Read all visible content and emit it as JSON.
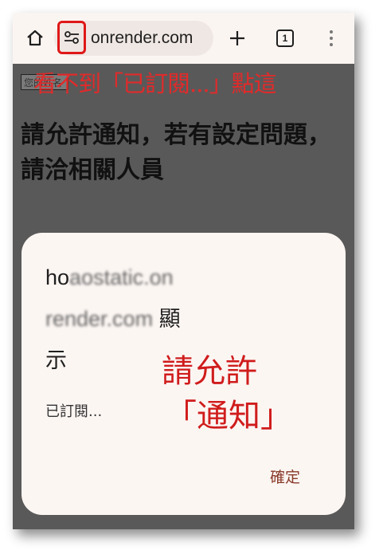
{
  "browser": {
    "url_display": "onrender.com",
    "tab_count": "1",
    "icons": {
      "home": "home-icon",
      "site_settings": "tune-icon",
      "new_tab": "plus-icon",
      "tabs": "tab-switcher-icon",
      "menu": "more-vert-icon"
    }
  },
  "page": {
    "input_placeholder": "您的姓名",
    "heading": "請允許通知，若有設定問題，請洽相關人員"
  },
  "annotations": {
    "top_tip": "看不到「已訂閱...」點這",
    "dialog_tip_line1": "請允許",
    "dialog_tip_line2": "「通知」"
  },
  "dialog": {
    "site_prefix": "ho",
    "site_blurred_1": "aostatic.on",
    "site_blurred_2": "render.com",
    "site_suffix": " 顯",
    "title_end": "示",
    "subtitle": "已訂閱...",
    "ok_label": "確定"
  },
  "colors": {
    "annotation_red": "#e22a2a",
    "highlight_box": "#e01818",
    "ok_text": "#8a3a2a",
    "dim_overlay": "#595959"
  }
}
